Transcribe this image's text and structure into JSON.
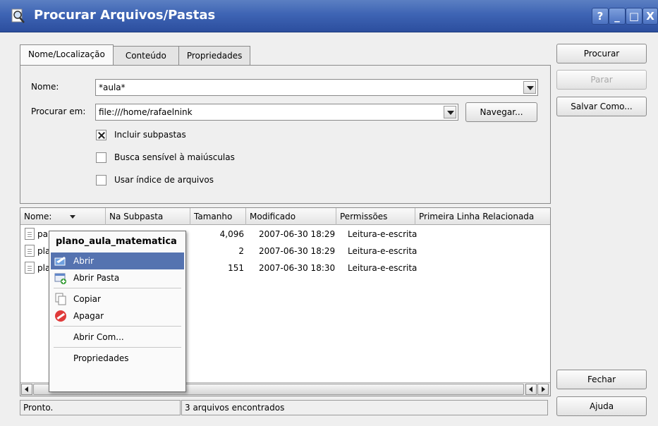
{
  "window": {
    "title": "Procurar Arquivos/Pastas",
    "buttons": [
      "?",
      "_",
      "□",
      "X"
    ]
  },
  "tabs": [
    {
      "label": "Nome/Localização",
      "active": true
    },
    {
      "label": "Conteúdo"
    },
    {
      "label": "Propriedades"
    }
  ],
  "form": {
    "name_label": "Nome:",
    "name_value": "*aula*",
    "search_in_label": "Procurar em:",
    "search_in_value": "file:///home/rafaelnink",
    "browse_button": "Navegar...",
    "checkboxes": [
      {
        "label": "Incluir subpastas",
        "checked": true
      },
      {
        "label": "Busca sensível à maiúsculas",
        "checked": false
      },
      {
        "label": "Usar índice de arquivos",
        "checked": false
      }
    ]
  },
  "actions": {
    "search": "Procurar",
    "stop": "Parar",
    "save_as": "Salvar Como...",
    "close": "Fechar",
    "help": "Ajuda"
  },
  "results": {
    "columns": [
      "Nome:",
      "Na Subpasta",
      "Tamanho",
      "Modificado",
      "Permissões",
      "Primeira Linha Relacionada"
    ],
    "rows": [
      {
        "name": "pa",
        "size": "4,096",
        "modified": "2007-06-30 18:29",
        "permissions": "Leitura-e-escrita"
      },
      {
        "name": "pla",
        "size": "2",
        "modified": "2007-06-30 18:29",
        "permissions": "Leitura-e-escrita"
      },
      {
        "name": "pla",
        "size": "151",
        "modified": "2007-06-30 18:30",
        "permissions": "Leitura-e-escrita"
      }
    ]
  },
  "context_menu": {
    "title": "plano_aula_matematica",
    "items": [
      "Abrir",
      "Abrir Pasta",
      "Copiar",
      "Apagar",
      "Abrir Com...",
      "Propriedades"
    ]
  },
  "status": {
    "left": "Pronto.",
    "right": "3 arquivos encontrados"
  },
  "colors": {
    "titlebar": "#3e64b4",
    "highlight": "#5573b0"
  }
}
